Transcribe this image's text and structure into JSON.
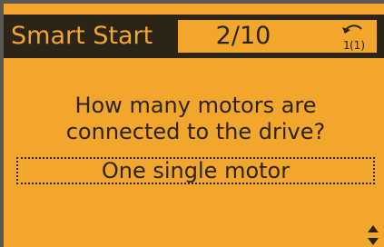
{
  "header": {
    "title": "Smart Start",
    "step": "2/10",
    "back_icon": "back-arrow-icon"
  },
  "main": {
    "question": "How many motors are\nconnected to the drive?",
    "selected_answer": "One single motor"
  },
  "colors": {
    "lcd_background": "#f2a62c",
    "lcd_text": "#2c2418",
    "header_background": "#2d2418",
    "bezel": "#5a5852"
  }
}
